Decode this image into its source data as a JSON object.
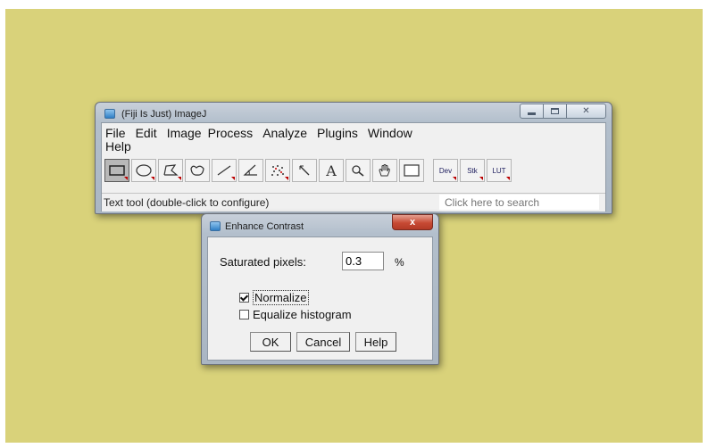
{
  "main_window": {
    "title": "(Fiji Is Just) ImageJ",
    "menu": [
      "File",
      "Edit",
      "Image",
      "Process",
      "Analyze",
      "Plugins",
      "Window",
      "Help"
    ],
    "tools": [
      {
        "name": "rectangle-tool-icon",
        "selected": true
      },
      {
        "name": "oval-tool-icon"
      },
      {
        "name": "polygon-tool-icon"
      },
      {
        "name": "freehand-tool-icon"
      },
      {
        "name": "line-tool-icon"
      },
      {
        "name": "angle-tool-icon"
      },
      {
        "name": "multipoint-tool-icon"
      },
      {
        "name": "wand-tool-icon"
      },
      {
        "name": "text-tool-icon",
        "glyph": "A"
      },
      {
        "name": "magnifier-tool-icon"
      },
      {
        "name": "hand-tool-icon"
      },
      {
        "name": "color-picker-tool-icon"
      },
      {
        "name": "dev-tool",
        "label": "Dev"
      },
      {
        "name": "stk-tool",
        "label": "Stk"
      },
      {
        "name": "lut-tool",
        "label": "LUT"
      }
    ],
    "status_text": "Text tool (double-click to configure)",
    "search_placeholder": "Click here to search"
  },
  "dialog": {
    "title": "Enhance Contrast",
    "close_label": "x",
    "saturated_label": "Saturated pixels:",
    "saturated_value": "0.3",
    "percent_unit": "%",
    "normalize_label": "Normalize",
    "normalize_checked": true,
    "equalize_label": "Equalize histogram",
    "equalize_checked": false,
    "buttons": {
      "ok": "OK",
      "cancel": "Cancel",
      "help": "Help"
    }
  },
  "colors": {
    "desktop": "#d9d27a",
    "window_frame": "#b3bfcc",
    "close_button": "#c74a34"
  }
}
